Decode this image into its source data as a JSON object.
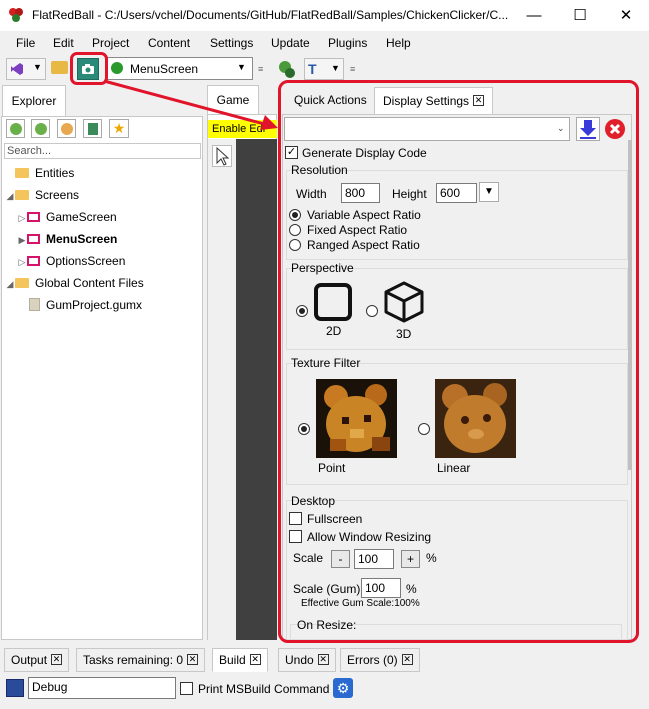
{
  "window": {
    "title": "FlatRedBall - C:/Users/vchel/Documents/GitHub/FlatRedBall/Samples/ChickenClicker/C...",
    "minimize": "—",
    "maximize": "☐",
    "close": "✕"
  },
  "menu": [
    "File",
    "Edit",
    "Project",
    "Content",
    "Settings",
    "Update",
    "Plugins",
    "Help"
  ],
  "toolbar": {
    "screen_select": "MenuScreen"
  },
  "explorer": {
    "tab": "Explorer",
    "search_placeholder": "Search...",
    "tree": [
      {
        "label": "Entities"
      },
      {
        "label": "Screens"
      },
      {
        "label": "GameScreen"
      },
      {
        "label": "MenuScreen"
      },
      {
        "label": "OptionsScreen"
      },
      {
        "label": "Global Content Files"
      },
      {
        "label": "GumProject.gumx"
      }
    ]
  },
  "game": {
    "tab": "Game",
    "banner": "Enable Edi"
  },
  "display_settings": {
    "tabs": [
      "Quick Actions",
      "Display Settings"
    ],
    "generate_code_label": "Generate Display Code",
    "resolution": {
      "title": "Resolution",
      "width_label": "Width",
      "width_value": "800",
      "height_label": "Height",
      "height_value": "600",
      "aspect_options": [
        "Variable Aspect Ratio",
        "Fixed Aspect Ratio",
        "Ranged Aspect Ratio"
      ]
    },
    "perspective": {
      "title": "Perspective",
      "options": [
        "2D",
        "3D"
      ]
    },
    "texture_filter": {
      "title": "Texture Filter",
      "options": [
        "Point",
        "Linear"
      ]
    },
    "desktop": {
      "title": "Desktop",
      "fullscreen_label": "Fullscreen",
      "resizing_label": "Allow Window Resizing",
      "scale_label": "Scale",
      "scale_minus": "-",
      "scale_value": "100",
      "scale_plus": "+",
      "percent": "%",
      "scale_gum_label": "Scale (Gum)",
      "scale_gum_value": "100",
      "scale_gum_percent": "%",
      "effective_label": "Effective Gum Scale:100%",
      "on_resize_label": "On Resize:"
    }
  },
  "bottom_tabs": [
    "Output",
    "Tasks remaining: 0",
    "Build",
    "Undo",
    "Errors (0)"
  ],
  "status": {
    "config_value": "Debug",
    "print_label": "Print MSBuild Command"
  },
  "colors": {
    "highlight": "#e0142a",
    "game_banner": "#ffff00"
  }
}
